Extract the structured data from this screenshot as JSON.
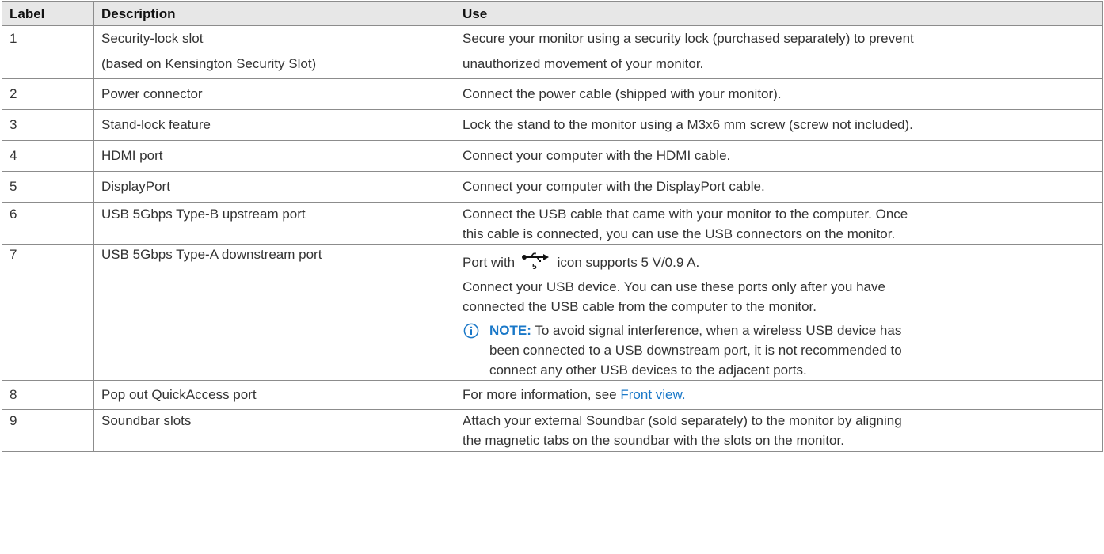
{
  "table": {
    "headers": {
      "label": "Label",
      "description": "Description",
      "use": "Use"
    },
    "rows": [
      {
        "label": "1",
        "description": [
          "Security-lock slot",
          "(based on Kensington Security Slot)"
        ],
        "use": [
          "Secure your monitor using a security lock (purchased separately) to prevent",
          "unauthorized movement of your monitor."
        ]
      },
      {
        "label": "2",
        "description": "Power connector",
        "use": "Connect the power cable (shipped with your monitor)."
      },
      {
        "label": "3",
        "description": "Stand-lock feature",
        "use": "Lock the stand to the monitor using a M3x6 mm screw (screw not included)."
      },
      {
        "label": "4",
        "description": "HDMI port",
        "use": "Connect your computer with the HDMI cable."
      },
      {
        "label": "5",
        "description": "DisplayPort",
        "use": "Connect your computer with the DisplayPort cable."
      },
      {
        "label": "6",
        "description": "USB 5Gbps Type-B upstream port",
        "use": [
          "Connect the USB cable that came with your monitor to the computer. Once",
          "this cable is connected, you can use the USB connectors on the monitor."
        ]
      },
      {
        "label": "7",
        "description": "USB 5Gbps Type-A downstream port",
        "use_before_icon": "Port with",
        "icon": "usb-5gbps-icon",
        "icon_mark": "5",
        "use_after_icon": "icon supports 5 V/0.9 A.",
        "use_para2": [
          "Connect your USB device. You can use these ports only after you have",
          "connected the USB cable from the computer to the monitor."
        ],
        "note": {
          "icon": "info-circle-icon",
          "label": "NOTE:",
          "text": [
            "To avoid signal interference, when a wireless USB device has",
            "been connected to a USB downstream port, it is not recommended to",
            "connect any other USB devices to the adjacent ports."
          ]
        }
      },
      {
        "label": "8",
        "description": "Pop out QuickAccess port",
        "use_before_link": "For more information, see",
        "link": "Front view."
      },
      {
        "label": "9",
        "description": "Soundbar slots",
        "use": [
          "Attach your external Soundbar (sold separately) to the monitor by aligning",
          "the magnetic tabs on the soundbar with the slots on the monitor."
        ]
      }
    ]
  },
  "colors": {
    "header_bg": "#e7e7e7",
    "border": "#8c8c8c",
    "text": "#333333",
    "accent": "#1a78c8"
  }
}
